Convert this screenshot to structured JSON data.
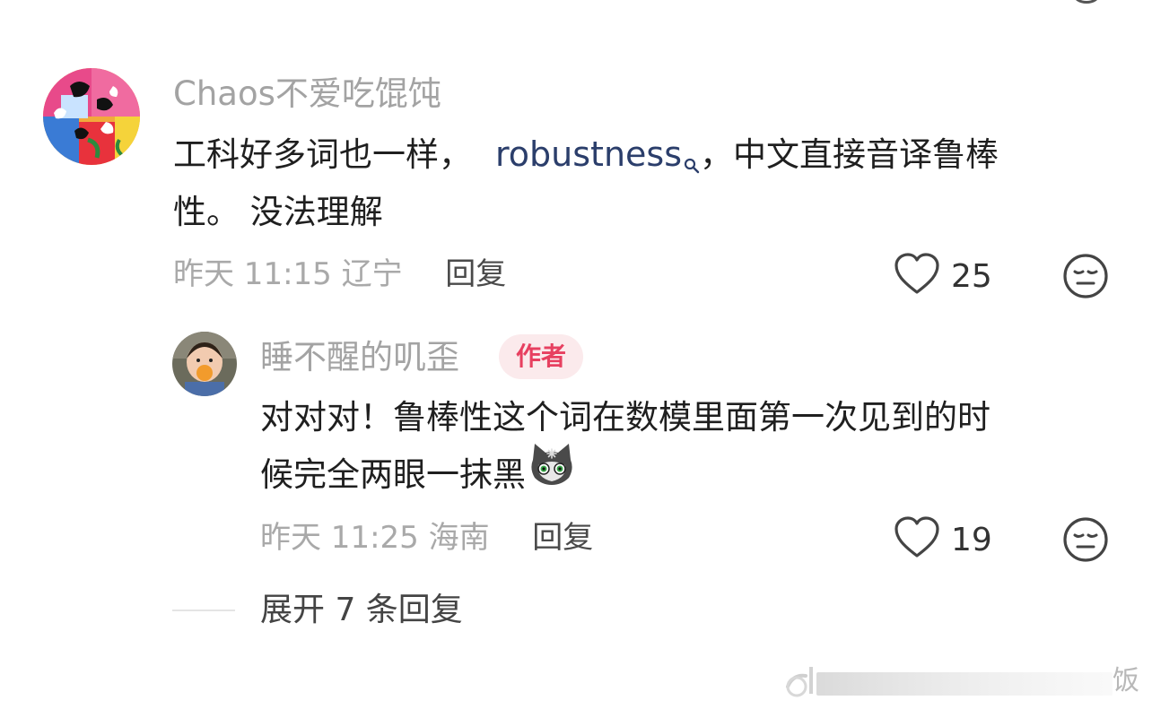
{
  "comments": [
    {
      "username": "Chaos不爱吃馄饨",
      "text_before_link": "工科好多词也一样，",
      "link_text": "robustness",
      "text_after_link": "，中文直接音译鲁棒",
      "text_line2": "性。 没法理解",
      "time": "昨天 11:15",
      "location": "辽宁",
      "reply_label": "回复",
      "likes": "25"
    }
  ],
  "reply": {
    "username": "睡不醒的叽歪",
    "badge": "作者",
    "text_line1": "对对对！鲁棒性这个词在数模里面第一次见到的时",
    "text_line2": "候完全两眼一抹黑",
    "time": "昨天 11:25",
    "location": "海南",
    "reply_label": "回复",
    "likes": "19"
  },
  "expand_label": "展开 7 条回复",
  "watermark": "饭",
  "colors": {
    "username": "#a3a3a3",
    "link": "#2b3e6b",
    "badge_bg": "#fbeaec",
    "badge_text": "#e74060"
  },
  "icons": [
    "heart-icon",
    "meh-face-icon",
    "search-icon",
    "cat-emoji-icon"
  ]
}
